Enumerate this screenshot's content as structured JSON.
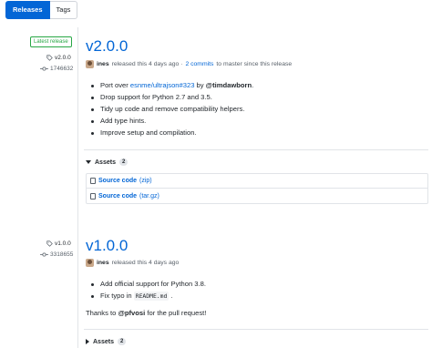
{
  "tabs": {
    "releases": "Releases",
    "tags": "Tags"
  },
  "releases": [
    {
      "badge": "Latest release",
      "tag": "v2.0.0",
      "commit": "1746632",
      "title": "v2.0.0",
      "author": "ines",
      "released_text": "released this 4 days ago ·",
      "commits_link": "2 commits",
      "commits_suffix": "to master since this release",
      "notes": {
        "n1_pre": "Port over ",
        "n1_link": "esnme/ultrajson#323",
        "n1_mid": " by ",
        "n1_user": "@timdawborn",
        "n1_post": ".",
        "n2": "Drop support for Python 2.7 and 3.5.",
        "n3": "Tidy up code and remove compatibility helpers.",
        "n4": "Add type hints.",
        "n5": "Improve setup and compilation."
      },
      "assets_label": "Assets",
      "assets_count": "2",
      "assets": [
        {
          "label": "Source code",
          "ext": "(zip)"
        },
        {
          "label": "Source code",
          "ext": "(tar.gz)"
        }
      ]
    },
    {
      "tag": "v1.0.0",
      "commit": "3318655",
      "title": "v1.0.0",
      "author": "ines",
      "released_text": "released this 4 days ago",
      "notes": {
        "n1": "Add official support for Python 3.8.",
        "n2_pre": "Fix typo in ",
        "n2_code": "README.md",
        "n2_post": " ."
      },
      "thanks_pre": "Thanks to ",
      "thanks_user": "@pfvosi",
      "thanks_post": " for the pull request!",
      "assets_label": "Assets",
      "assets_count": "2"
    }
  ]
}
